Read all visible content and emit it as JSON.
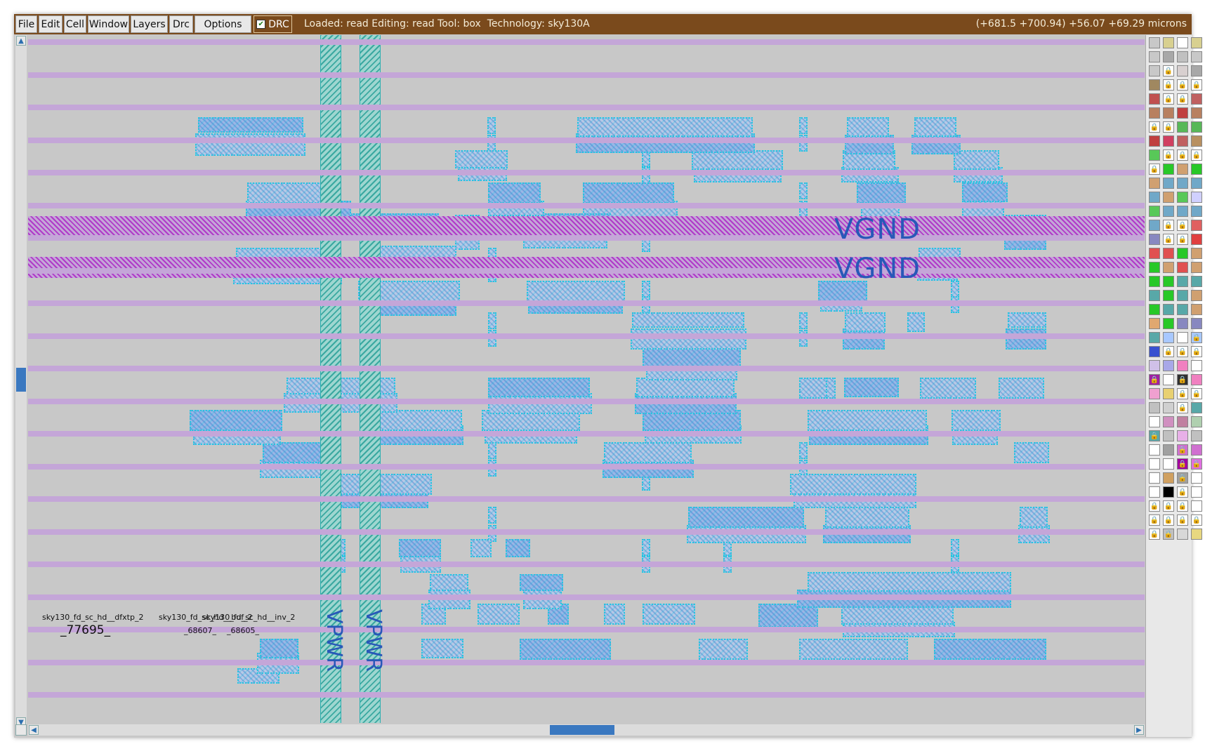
{
  "menu": {
    "items": [
      "File",
      "Edit",
      "Cell",
      "Window",
      "Layers",
      "Drc",
      "Options"
    ],
    "drc_label": "DRC",
    "drc_checked": true
  },
  "status": {
    "text": "Loaded: read Editing: read Tool: box  Technology: sky130A",
    "coords": "(+681.5 +700.94) +56.07 +69.29 microns"
  },
  "layout": {
    "rail_labels": [
      "VGND",
      "VGND"
    ],
    "power_labels": [
      "VPWR",
      "VPWR"
    ],
    "cell_names": [
      "sky130_fd_sc_hd__dfxtp_2",
      "sky130_fd_sc_hd__buf_2",
      "sky130_fd_sc_hd__inv_2"
    ],
    "instance_names": [
      "_77695_",
      "_68607_",
      "_68605_"
    ]
  },
  "colors": {
    "titlebar": "#7a4a1c",
    "canvas_bg": "#c8c8c8",
    "row_stripe": "#c4a6d8",
    "rail": "#b03ac8",
    "cell_outline": "#22c8e0",
    "label_blue": "#2858b8",
    "scroll_thumb": "#3a78c0"
  },
  "icons": [
    "scroll-up-arrow-icon",
    "scroll-down-arrow-icon",
    "scroll-left-arrow-icon",
    "scroll-right-arrow-icon",
    "lock-icon",
    "checkbox-icon"
  ]
}
